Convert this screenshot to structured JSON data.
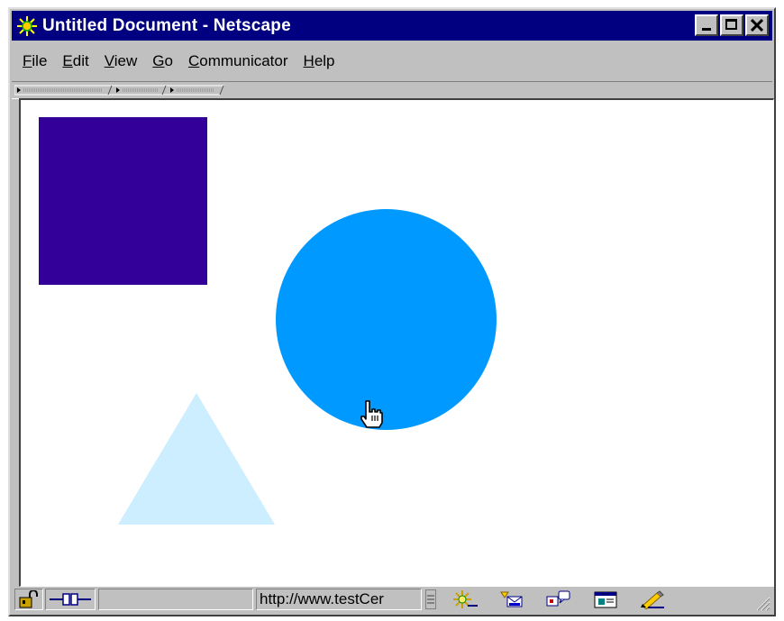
{
  "window": {
    "title": "Untitled Document - Netscape",
    "icon": "netscape-logo-icon"
  },
  "menu": [
    {
      "label": "File",
      "mnemonic": "F"
    },
    {
      "label": "Edit",
      "mnemonic": "E"
    },
    {
      "label": "View",
      "mnemonic": "V"
    },
    {
      "label": "Go",
      "mnemonic": "G"
    },
    {
      "label": "Communicator",
      "mnemonic": "C"
    },
    {
      "label": "Help",
      "mnemonic": "H"
    }
  ],
  "content": {
    "shapes": [
      {
        "type": "square",
        "color": "#330099"
      },
      {
        "type": "circle",
        "color": "#0099ff"
      },
      {
        "type": "triangle",
        "color": "#cceeff"
      }
    ],
    "cursor": "hand-pointer-icon"
  },
  "statusbar": {
    "security_icon": "unlocked-padlock-icon",
    "connection_icon": "plug-icon",
    "status_text": "http://www.testCer",
    "component_icons": [
      "navigator-icon",
      "mail-icon",
      "discussion-icon",
      "composer-icon",
      "edit-pencil-icon"
    ]
  }
}
